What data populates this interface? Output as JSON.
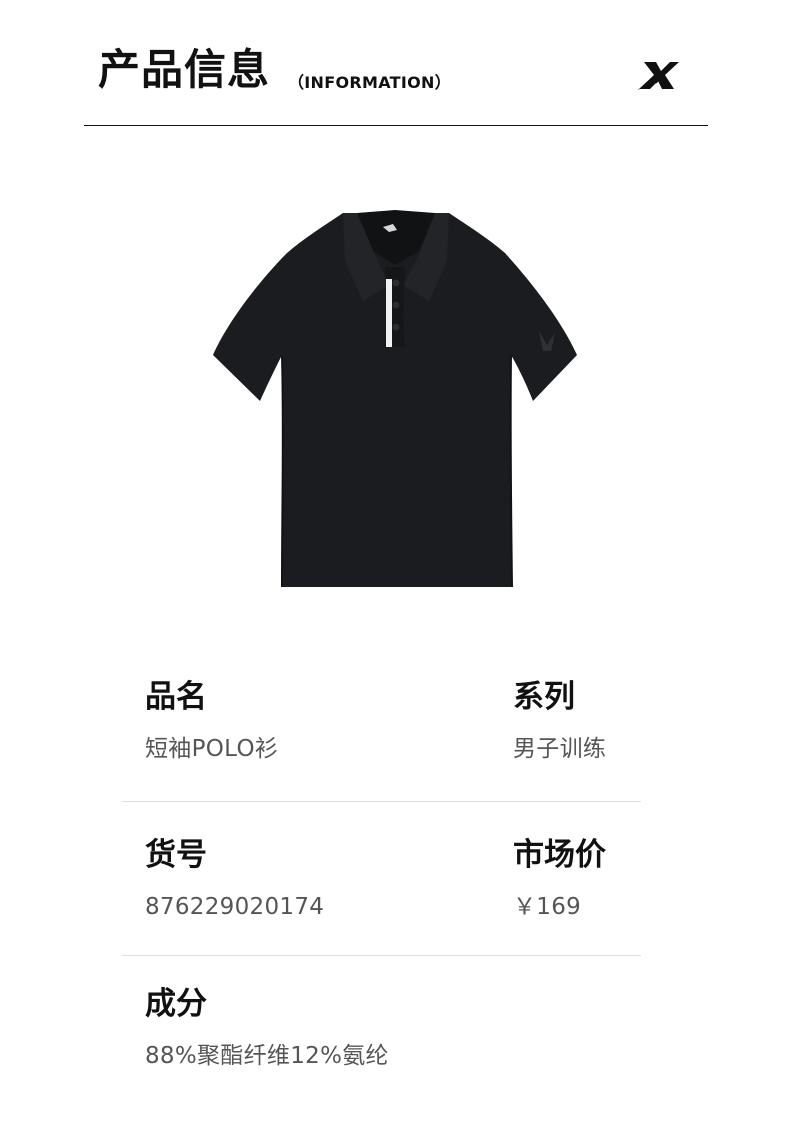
{
  "header": {
    "title": "产品信息",
    "subtitle": "（INFORMATION）",
    "logo_icon": "brand-x-logo"
  },
  "product": {
    "image_icon": "black-polo-shirt",
    "shirt_color": "#1b1c1f"
  },
  "specs": {
    "name": {
      "label": "品名",
      "value": "短袖POLO衫"
    },
    "series": {
      "label": "系列",
      "value": "男子训练"
    },
    "item_no": {
      "label": "货号",
      "value": "876229020174"
    },
    "price": {
      "label": "市场价",
      "value": "￥169"
    },
    "composition": {
      "label": "成分",
      "value": "88%聚酯纤维12%氨纶"
    }
  },
  "colors": {
    "label_text": "#111111",
    "value_text": "#555555",
    "divider": "#dedede"
  }
}
